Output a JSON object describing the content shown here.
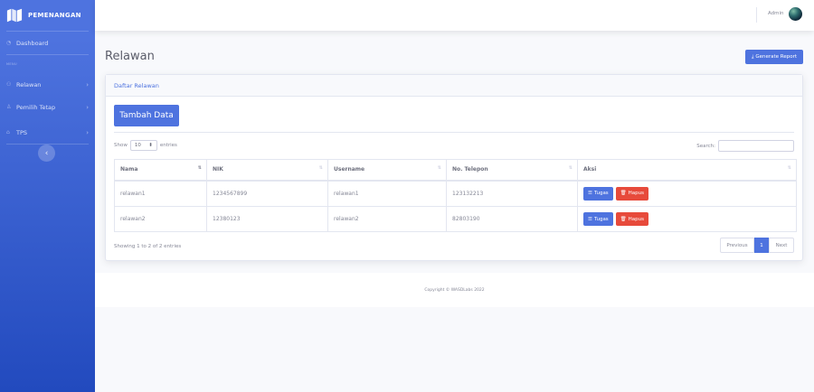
{
  "brand": {
    "name": "PEMENANGAN",
    "logo_icon": "map-icon"
  },
  "sidebar": {
    "dashboard": {
      "label": "Dashboard",
      "icon": "tachometer-icon"
    },
    "heading": "MENU",
    "items": [
      {
        "label": "Relawan",
        "icon": "users-icon"
      },
      {
        "label": "Pemilih Tetap",
        "icon": "user-icon"
      },
      {
        "label": "TPS",
        "icon": "building-icon"
      }
    ],
    "toggle_glyph": "‹"
  },
  "topbar": {
    "user_name": "Admin"
  },
  "page": {
    "title": "Relawan",
    "report_button": "Generate Report"
  },
  "card": {
    "header": "Daftar Relawan",
    "add_button": "Tambah Data",
    "show_label": "Show",
    "entries_value": "10",
    "entries_label": "entries",
    "search_label": "Search:",
    "columns": [
      "Nama",
      "NIK",
      "Username",
      "No. Telepon",
      "Aksi"
    ],
    "rows": [
      {
        "nama": "relawan1",
        "nik": "1234567899",
        "username": "relawan1",
        "telepon": "123132213"
      },
      {
        "nama": "relawan2",
        "nik": "12380123",
        "username": "relawan2",
        "telepon": "82803190"
      }
    ],
    "action_tugas": "Tugas",
    "action_hapus": "Hapus",
    "info": "Showing 1 to 2 of 2 entries",
    "pagination": {
      "previous": "Previous",
      "current": "1",
      "next": "Next"
    }
  },
  "footer": {
    "copyright": "Copyright © WASDLabs 2022"
  },
  "colors": {
    "primary": "#4e73df",
    "danger": "#e74a3b",
    "sidebar_dark": "#224abe"
  }
}
